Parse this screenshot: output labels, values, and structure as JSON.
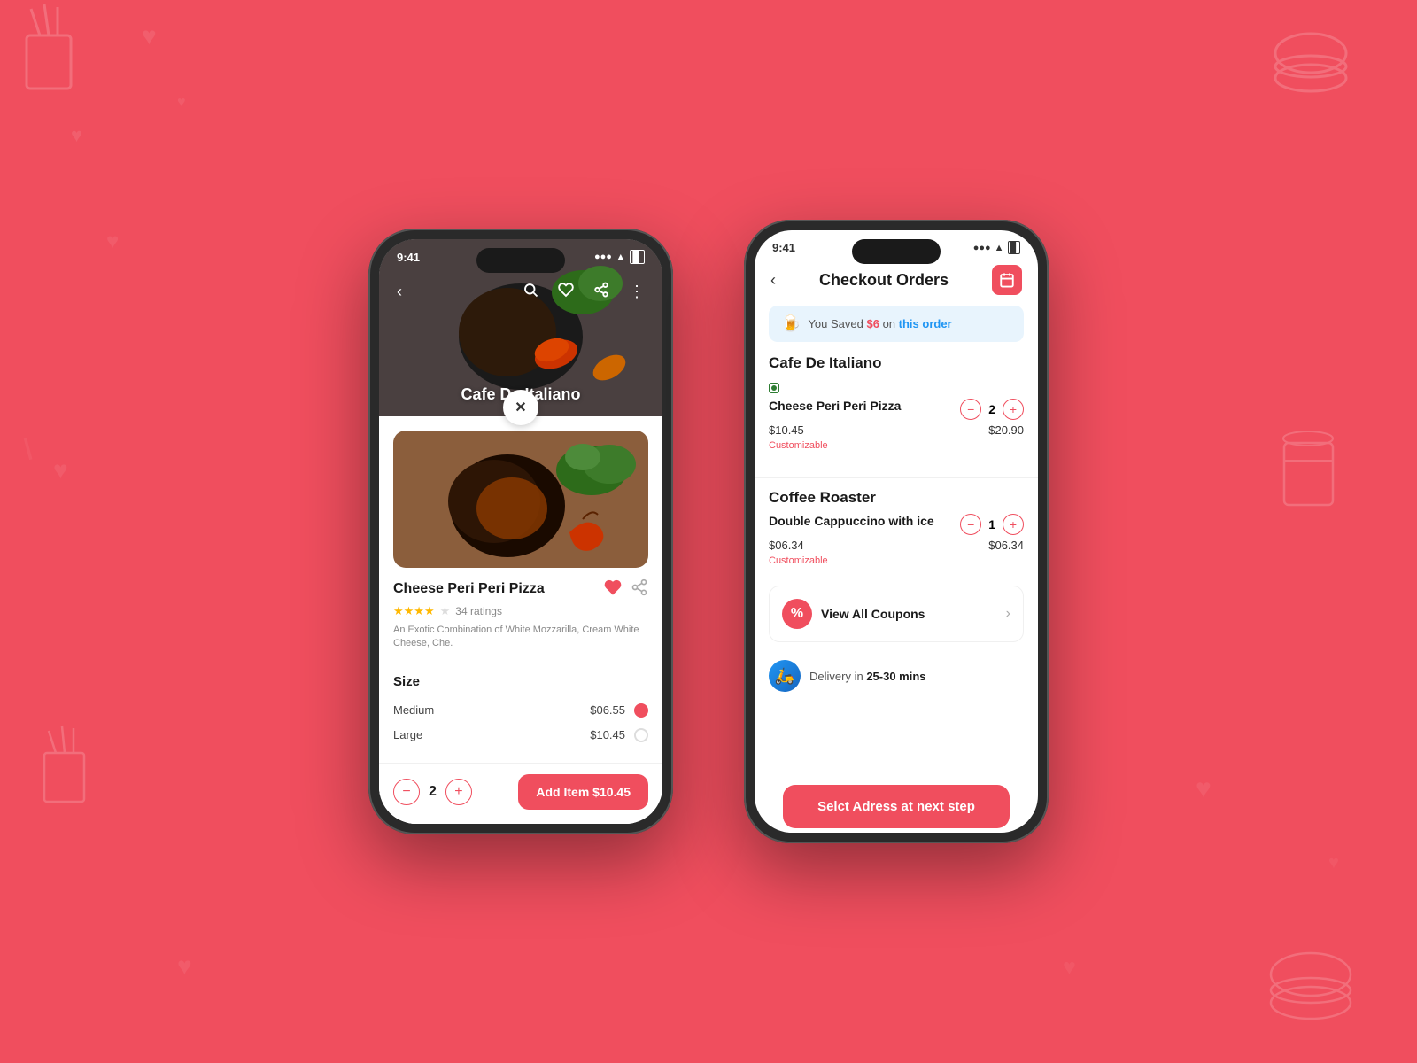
{
  "background": {
    "color": "#f04e5e"
  },
  "left_phone": {
    "status_bar": {
      "time": "9:41",
      "signal": "●●●●",
      "wifi": "wifi",
      "battery": "battery"
    },
    "restaurant_name": "Cafe De Italiano",
    "close_button_label": "✕",
    "food_item": {
      "name": "Cheese Peri Peri Pizza",
      "rating": "3.5",
      "rating_count": "34 ratings",
      "description": "An Exotic Combination of White Mozzarilla, Cream White Cheese, Che.",
      "stars": [
        true,
        true,
        true,
        true,
        false
      ]
    },
    "size_section": {
      "title": "Size",
      "options": [
        {
          "name": "Medium",
          "price": "$06.55",
          "selected": true
        },
        {
          "name": "Large",
          "price": "$10.45",
          "selected": false
        }
      ]
    },
    "quantity": "2",
    "add_item_btn": "Add Item $10.45",
    "minus_label": "−",
    "plus_label": "+"
  },
  "right_phone": {
    "status_bar": {
      "time": "9:41"
    },
    "header": {
      "back_label": "‹",
      "title": "Checkout Orders",
      "calendar_icon": "📅"
    },
    "savings_banner": {
      "emoji": "🍺",
      "text_before": "You Saved",
      "amount": "$6",
      "text_middle": "on",
      "link": "this order"
    },
    "restaurants": [
      {
        "name": "Cafe De Italiano",
        "items": [
          {
            "name": "Cheese Peri Peri Pizza",
            "quantity": "2",
            "unit_price": "$10.45",
            "total_price": "$20.90",
            "customizable": "Customizable"
          }
        ]
      },
      {
        "name": "Coffee Roaster",
        "items": [
          {
            "name": "Double Cappuccino with ice",
            "quantity": "1",
            "unit_price": "$06.34",
            "total_price": "$06.34",
            "customizable": "Customizable"
          }
        ]
      }
    ],
    "coupons": {
      "icon": "%",
      "label": "View All Coupons",
      "chevron": "›"
    },
    "delivery": {
      "icon": "🛵",
      "text_before": "Delivery in",
      "time": "25-30 mins"
    },
    "cta_button": "Selct Adress at next step",
    "minus_label": "−",
    "plus_label": "+"
  }
}
